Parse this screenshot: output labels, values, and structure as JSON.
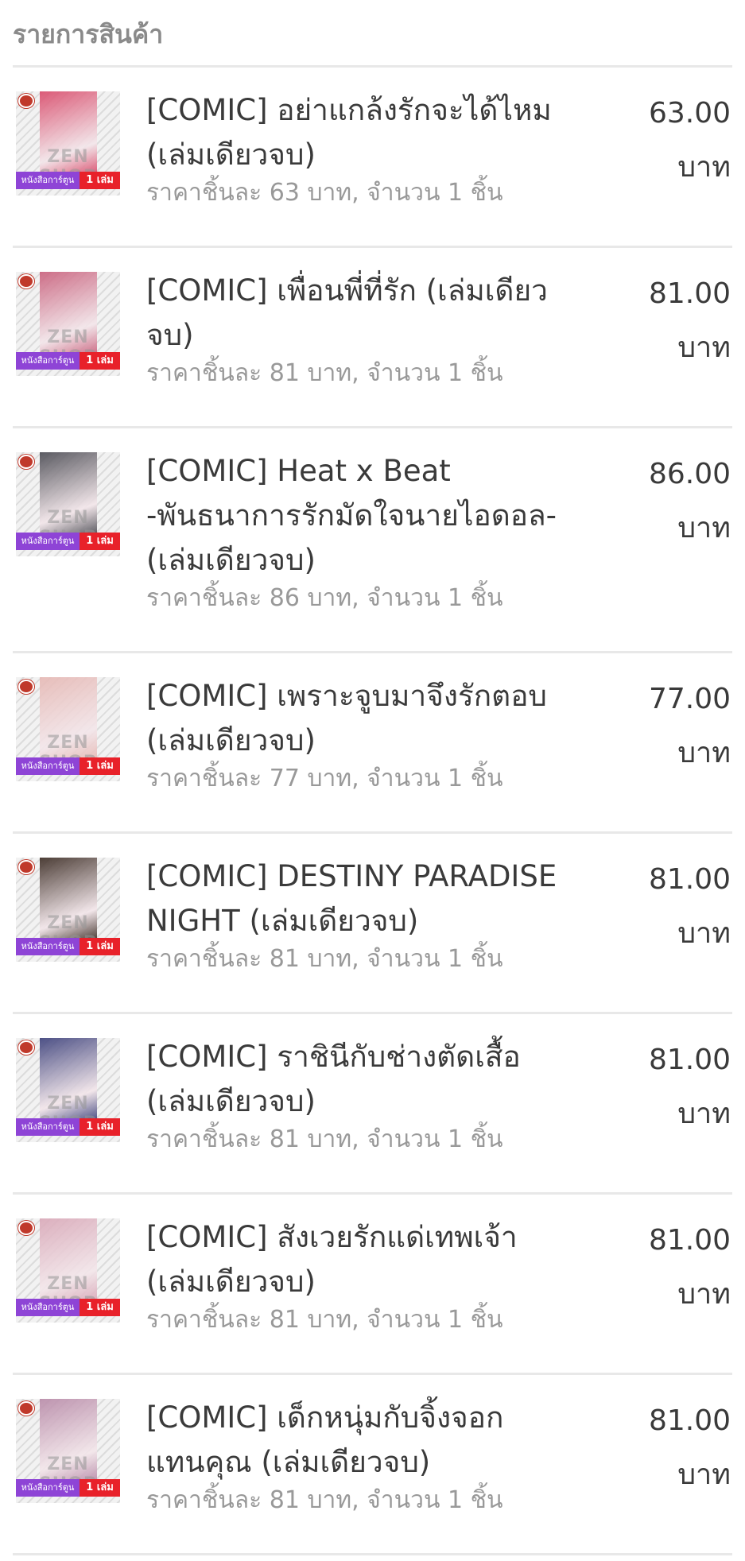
{
  "section_title": "รายการสินค้า",
  "thumb_watermark": "ZEN SHOP",
  "thumb_badge_left": "หนังสือการ์ตูน",
  "thumb_badge_right": "1 เล่ม",
  "items": [
    {
      "title": "[COMIC] อย่าแกล้งรักจะได้ไหม (เล่มเดียวจบ)",
      "detail": "ราคาชิ้นละ 63 บาท, จำนวน 1 ชิ้น",
      "price": "63.00",
      "unit": "บาท",
      "cover_color": "#d94a6a"
    },
    {
      "title": "[COMIC] เพื่อนพี่ที่รัก (เล่มเดียวจบ)",
      "detail": "ราคาชิ้นละ 81 บาท, จำนวน 1 ชิ้น",
      "price": "81.00",
      "unit": "บาท",
      "cover_color": "#c9607c"
    },
    {
      "title": "[COMIC] Heat x Beat -พันธนาการรักมัดใจนายไอดอล- (เล่มเดียวจบ)",
      "detail": "ราคาชิ้นละ 86 บาท, จำนวน 1 ชิ้น",
      "price": "86.00",
      "unit": "บาท",
      "cover_color": "#4a4a52"
    },
    {
      "title": "[COMIC] เพราะจูบมาจึงรักตอบ (เล่มเดียวจบ)",
      "detail": "ราคาชิ้นละ 77 บาท, จำนวน 1 ชิ้น",
      "price": "77.00",
      "unit": "บาท",
      "cover_color": "#e6b8b4"
    },
    {
      "title": "[COMIC] DESTINY PARADISE NIGHT (เล่มเดียวจบ)",
      "detail": "ราคาชิ้นละ 81 บาท, จำนวน 1 ชิ้น",
      "price": "81.00",
      "unit": "บาท",
      "cover_color": "#3a2a22"
    },
    {
      "title": "[COMIC] ราชินีกับช่างตัดเสื้อ (เล่มเดียวจบ)",
      "detail": "ราคาชิ้นละ 81 บาท, จำนวน 1 ชิ้น",
      "price": "81.00",
      "unit": "บาท",
      "cover_color": "#3b3f7a"
    },
    {
      "title": "[COMIC] สังเวยรักแด่เทพเจ้า (เล่มเดียวจบ)",
      "detail": "ราคาชิ้นละ 81 บาท, จำนวน 1 ชิ้น",
      "price": "81.00",
      "unit": "บาท",
      "cover_color": "#d9a8b8"
    },
    {
      "title": "[COMIC] เด็กหนุ่มกับจิ้งจอกแทนคุณ (เล่มเดียวจบ)",
      "detail": "ราคาชิ้นละ 81 บาท, จำนวน 1 ชิ้น",
      "price": "81.00",
      "unit": "บาท",
      "cover_color": "#b88aa8"
    }
  ]
}
